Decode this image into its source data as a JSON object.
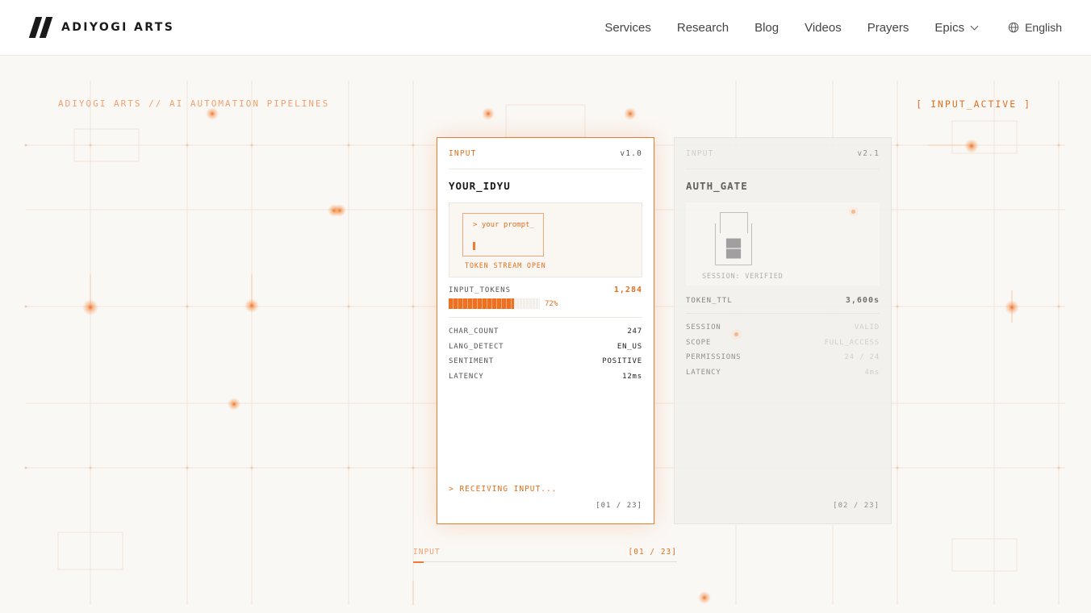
{
  "header": {
    "brand": "ADIYOGI ARTS",
    "nav": [
      "Services",
      "Research",
      "Blog",
      "Videos",
      "Prayers"
    ],
    "epics_label": "Epics",
    "language": "English"
  },
  "hero": {
    "tag_left": "ADIYOGI ARTS // AI AUTOMATION PIPELINES",
    "tag_right": "[ INPUT_ACTIVE ]"
  },
  "card_active": {
    "label": "INPUT",
    "version": "v1.0",
    "title": "YOUR_IDYU",
    "prompt_text": "> your prompt_",
    "viz_caption": "TOKEN STREAM OPEN",
    "metric_name": "INPUT_TOKENS",
    "metric_value": "1,284",
    "progress_pct": 72,
    "progress_label": "72%",
    "stats": [
      {
        "k": "CHAR_COUNT",
        "v": "247"
      },
      {
        "k": "LANG_DETECT",
        "v": "EN_US"
      },
      {
        "k": "SENTIMENT",
        "v": "POSITIVE"
      },
      {
        "k": "LATENCY",
        "v": "12ms"
      }
    ],
    "status": "> RECEIVING INPUT...",
    "page": "[01 / 23]"
  },
  "card_next": {
    "label": "INPUT",
    "version": "v2.1",
    "title": "AUTH_GATE",
    "lock_block_1": "███",
    "lock_block_2": "███",
    "viz_caption": "SESSION: VERIFIED",
    "metric_name": "TOKEN_TTL",
    "metric_value": "3,600s",
    "stats": [
      {
        "k": "SESSION",
        "v": "VALID"
      },
      {
        "k": "SCOPE",
        "v": "FULL_ACCESS"
      },
      {
        "k": "PERMISSIONS",
        "v": "24 / 24"
      },
      {
        "k": "LATENCY",
        "v": "4ms"
      }
    ],
    "page": "[02 / 23]"
  },
  "carousel": {
    "label": "INPUT",
    "position": "[01 / 23]",
    "progress_fraction": 0.04
  },
  "colors": {
    "accent": "#ee7b30",
    "accent_dark": "#e07020",
    "background": "#faf8f5"
  },
  "icons": {
    "logo": "logo-mark-icon",
    "language": "globe-icon",
    "dropdown": "chevron-down-icon"
  }
}
